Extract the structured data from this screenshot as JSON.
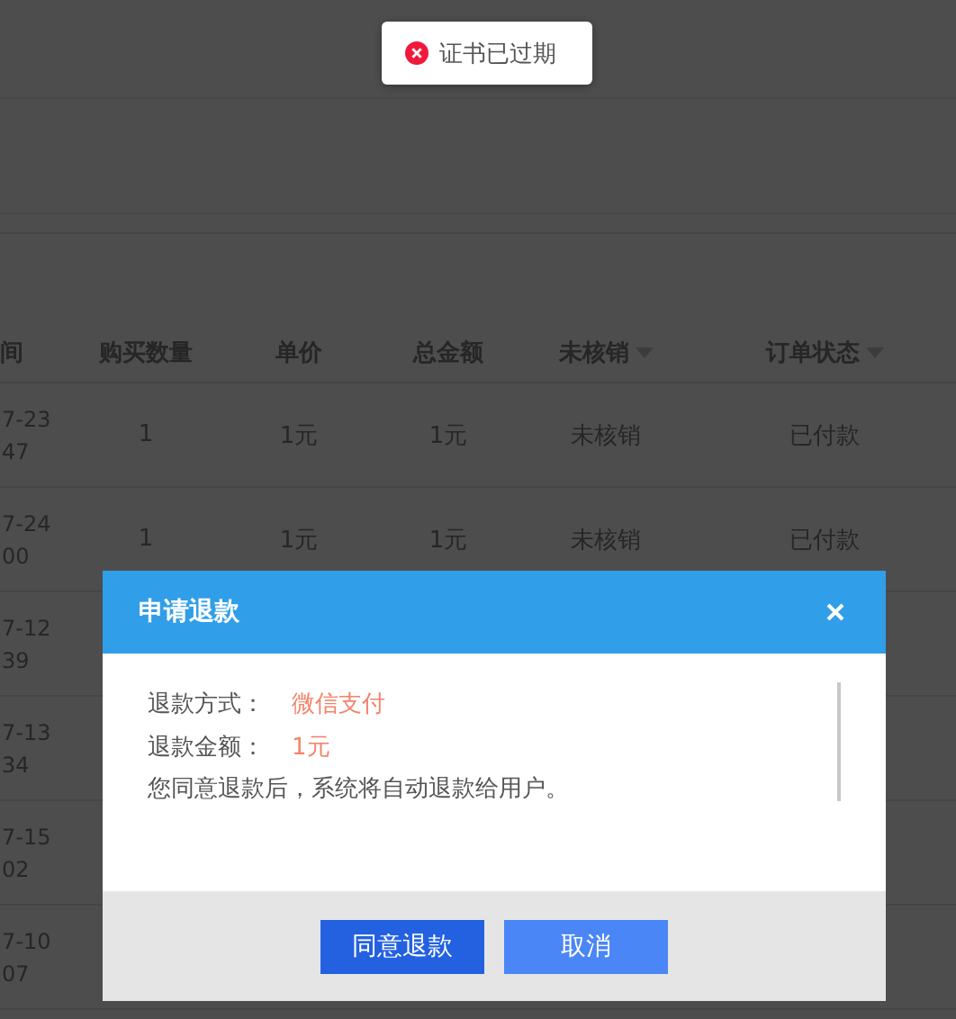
{
  "toast": {
    "kind": "error",
    "message": "证书已过期"
  },
  "table": {
    "columns": [
      {
        "label": "间",
        "filter": false
      },
      {
        "label": "购买数量",
        "filter": false
      },
      {
        "label": "单价",
        "filter": false
      },
      {
        "label": "总金额",
        "filter": false
      },
      {
        "label": "未核销",
        "filter": true
      },
      {
        "label": "订单状态",
        "filter": true
      }
    ],
    "rows": [
      {
        "time": [
          "7-23",
          "47"
        ],
        "quantity": "1",
        "price": "1元",
        "total": "1元",
        "verification": "未核销",
        "status": "已付款"
      },
      {
        "time": [
          "7-24",
          "00"
        ],
        "quantity": "1",
        "price": "1元",
        "total": "1元",
        "verification": "未核销",
        "status": "已付款"
      },
      {
        "time": [
          "7-12",
          "39"
        ]
      },
      {
        "time": [
          "7-13",
          "34"
        ]
      },
      {
        "time": [
          "7-15",
          "02"
        ]
      },
      {
        "time": [
          "7-10",
          "07"
        ]
      }
    ]
  },
  "dialog": {
    "title": "申请退款",
    "fields": [
      {
        "label": "退款方式：",
        "value": "微信支付"
      },
      {
        "label": "退款金额：",
        "value": "1元"
      }
    ],
    "note": "您同意退款后，系统将自动退款给用户。",
    "buttons": [
      {
        "label": "同意退款",
        "kind": "primary"
      },
      {
        "label": "取消",
        "kind": "secondary"
      }
    ]
  }
}
